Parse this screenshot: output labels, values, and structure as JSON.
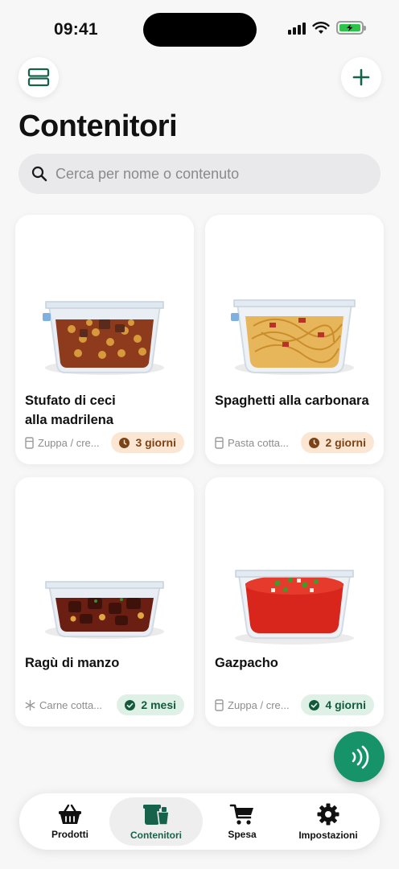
{
  "status_bar": {
    "time": "09:41"
  },
  "header": {
    "title": "Contenitori"
  },
  "search": {
    "placeholder": "Cerca per nome o contenuto"
  },
  "containers": [
    {
      "name": "Stufato di ceci alla madrilena",
      "category": "Zuppa / cre...",
      "category_icon": "fridge-icon",
      "expiry": "3 giorni",
      "status": "warning",
      "food": "chickpea-stew"
    },
    {
      "name": "Spaghetti alla carbonara",
      "category": "Pasta cotta...",
      "category_icon": "fridge-icon",
      "expiry": "2 giorni",
      "status": "warning",
      "food": "spaghetti"
    },
    {
      "name": "Ragù di manzo",
      "category": "Carne cotta...",
      "category_icon": "snowflake-icon",
      "expiry": "2 mesi",
      "status": "ok",
      "food": "beef-ragu"
    },
    {
      "name": "Gazpacho",
      "category": "Zuppa / cre...",
      "category_icon": "fridge-icon",
      "expiry": "4 giorni",
      "status": "ok",
      "food": "gazpacho"
    }
  ],
  "tabs": [
    {
      "label": "Prodotti",
      "icon": "basket-icon",
      "active": false
    },
    {
      "label": "Contenitori",
      "icon": "containers-icon",
      "active": true
    },
    {
      "label": "Spesa",
      "icon": "cart-icon",
      "active": false
    },
    {
      "label": "Impostazioni",
      "icon": "gear-icon",
      "active": false
    }
  ],
  "colors": {
    "accent": "#17936a",
    "warning_badge_bg": "#fbe6d3",
    "ok_badge_bg": "#dff0e6"
  }
}
